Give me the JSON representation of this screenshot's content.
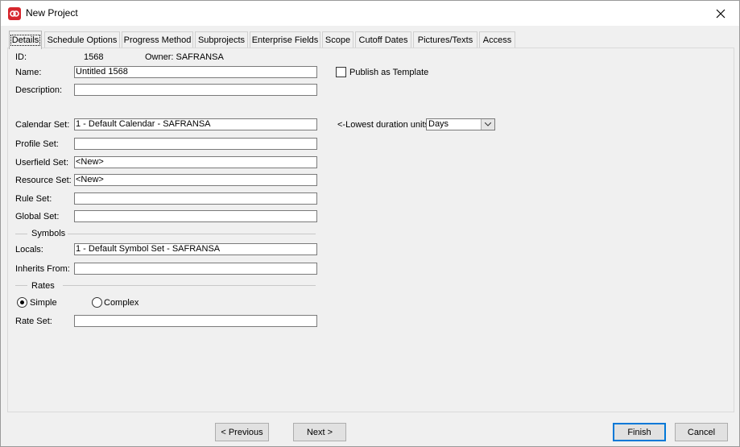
{
  "window": {
    "title": "New Project"
  },
  "tabs": [
    {
      "label": "Details"
    },
    {
      "label": "Schedule Options"
    },
    {
      "label": "Progress Method"
    },
    {
      "label": "Subprojects"
    },
    {
      "label": "Enterprise Fields"
    },
    {
      "label": "Scope"
    },
    {
      "label": "Cutoff Dates"
    },
    {
      "label": "Pictures/Texts"
    },
    {
      "label": "Access"
    }
  ],
  "details": {
    "id_label": "ID:",
    "id_value": "1568",
    "owner_label": "Owner: SAFRANSA",
    "name_label": "Name:",
    "name_value": "Untitled 1568",
    "publish_label": "Publish as Template",
    "description_label": "Description:",
    "description_value": "",
    "calendar_label": "Calendar Set:",
    "calendar_value": "1 - Default Calendar - SAFRANSA",
    "lowest_label": "<-Lowest duration units",
    "lowest_value": "Days",
    "profile_label": "Profile Set:",
    "profile_value": "",
    "userfield_label": "Userfield Set:",
    "userfield_value": "<New>",
    "resource_label": "Resource Set:",
    "resource_value": "<New>",
    "rule_label": "Rule Set:",
    "rule_value": "",
    "global_label": "Global Set:",
    "global_value": "",
    "symbols_header": "Symbols",
    "locals_label": "Locals:",
    "locals_value": "1 - Default Symbol Set - SAFRANSA",
    "inherits_label": "Inherits From:",
    "inherits_value": "",
    "rates_header": "Rates",
    "simple_label": "Simple",
    "complex_label": "Complex",
    "rateset_label": "Rate Set:",
    "rateset_value": ""
  },
  "footer": {
    "previous_label": "< Previous",
    "next_label": "Next >",
    "finish_label": "Finish",
    "cancel_label": "Cancel"
  }
}
